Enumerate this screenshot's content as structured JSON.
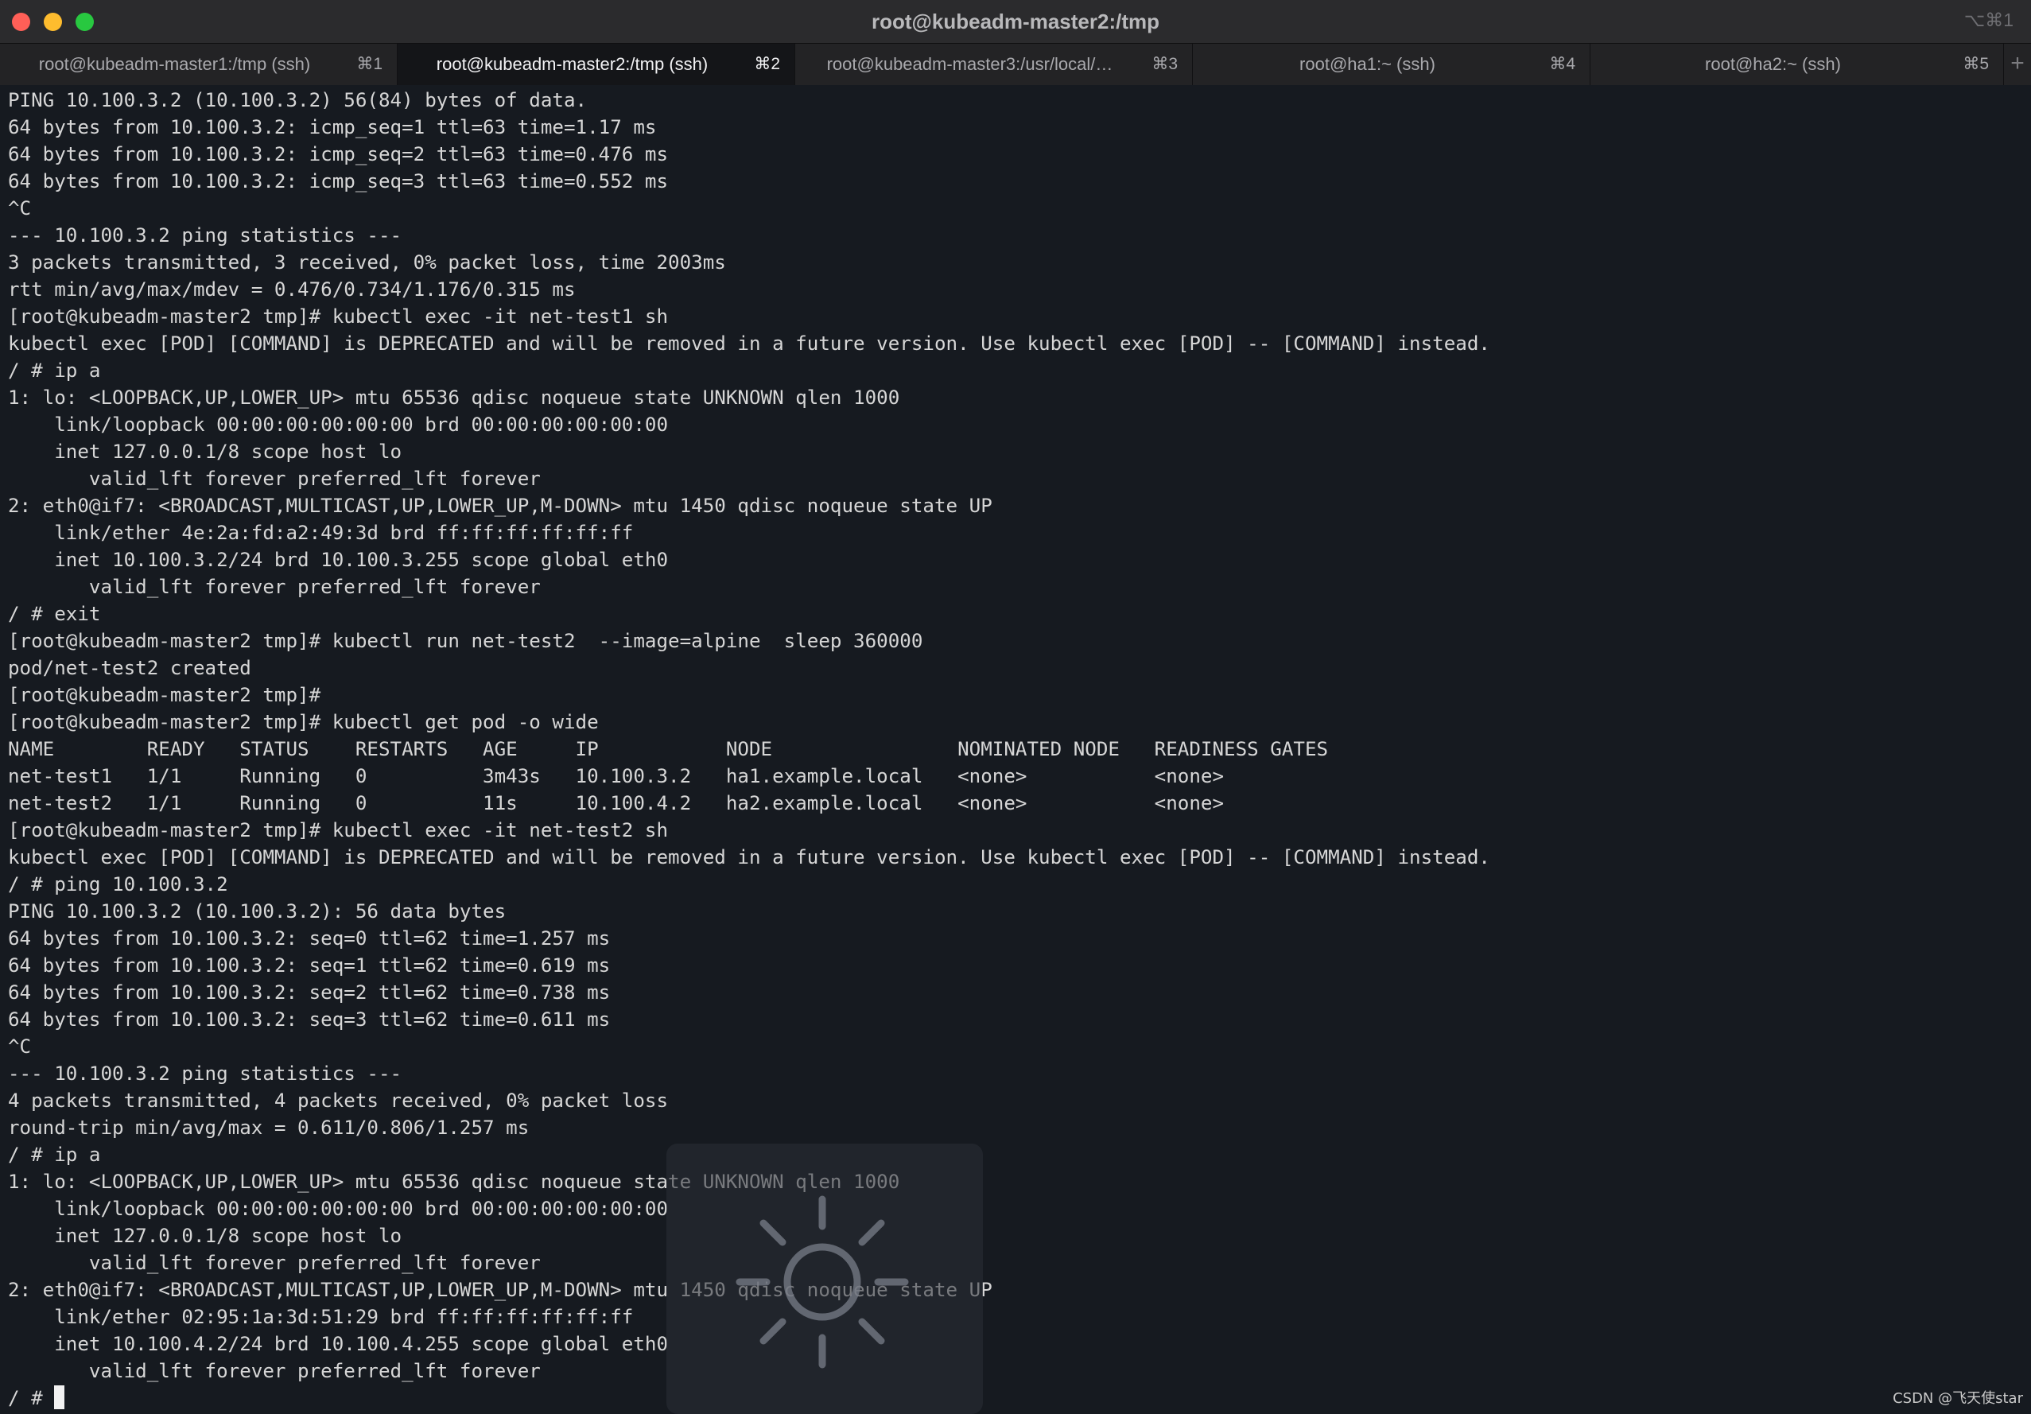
{
  "window": {
    "title": "root@kubeadm-master2:/tmp",
    "shortcut": "⌥⌘1"
  },
  "tabs": [
    {
      "label": "root@kubeadm-master1:/tmp (ssh)",
      "shortcut": "⌘1",
      "active": false
    },
    {
      "label": "root@kubeadm-master2:/tmp (ssh)",
      "shortcut": "⌘2",
      "active": true
    },
    {
      "label": "root@kubeadm-master3:/usr/local/…",
      "shortcut": "⌘3",
      "active": false
    },
    {
      "label": "root@ha1:~ (ssh)",
      "shortcut": "⌘4",
      "active": false
    },
    {
      "label": "root@ha2:~ (ssh)",
      "shortcut": "⌘5",
      "active": false
    }
  ],
  "new_tab_label": "+",
  "terminal": {
    "lines": [
      "PING 10.100.3.2 (10.100.3.2) 56(84) bytes of data.",
      "64 bytes from 10.100.3.2: icmp_seq=1 ttl=63 time=1.17 ms",
      "64 bytes from 10.100.3.2: icmp_seq=2 ttl=63 time=0.476 ms",
      "64 bytes from 10.100.3.2: icmp_seq=3 ttl=63 time=0.552 ms",
      "^C",
      "--- 10.100.3.2 ping statistics ---",
      "3 packets transmitted, 3 received, 0% packet loss, time 2003ms",
      "rtt min/avg/max/mdev = 0.476/0.734/1.176/0.315 ms",
      "[root@kubeadm-master2 tmp]# kubectl exec -it net-test1 sh",
      "kubectl exec [POD] [COMMAND] is DEPRECATED and will be removed in a future version. Use kubectl exec [POD] -- [COMMAND] instead.",
      "/ # ip a",
      "1: lo: <LOOPBACK,UP,LOWER_UP> mtu 65536 qdisc noqueue state UNKNOWN qlen 1000",
      "    link/loopback 00:00:00:00:00:00 brd 00:00:00:00:00:00",
      "    inet 127.0.0.1/8 scope host lo",
      "       valid_lft forever preferred_lft forever",
      "2: eth0@if7: <BROADCAST,MULTICAST,UP,LOWER_UP,M-DOWN> mtu 1450 qdisc noqueue state UP",
      "    link/ether 4e:2a:fd:a2:49:3d brd ff:ff:ff:ff:ff:ff",
      "    inet 10.100.3.2/24 brd 10.100.3.255 scope global eth0",
      "       valid_lft forever preferred_lft forever",
      "/ # exit",
      "[root@kubeadm-master2 tmp]# kubectl run net-test2  --image=alpine  sleep 360000",
      "pod/net-test2 created",
      "[root@kubeadm-master2 tmp]#",
      "[root@kubeadm-master2 tmp]# kubectl get pod -o wide",
      "NAME        READY   STATUS    RESTARTS   AGE     IP           NODE                NOMINATED NODE   READINESS GATES",
      "net-test1   1/1     Running   0          3m43s   10.100.3.2   ha1.example.local   <none>           <none>",
      "net-test2   1/1     Running   0          11s     10.100.4.2   ha2.example.local   <none>           <none>",
      "[root@kubeadm-master2 tmp]# kubectl exec -it net-test2 sh",
      "kubectl exec [POD] [COMMAND] is DEPRECATED and will be removed in a future version. Use kubectl exec [POD] -- [COMMAND] instead.",
      "/ # ping 10.100.3.2",
      "PING 10.100.3.2 (10.100.3.2): 56 data bytes",
      "64 bytes from 10.100.3.2: seq=0 ttl=62 time=1.257 ms",
      "64 bytes from 10.100.3.2: seq=1 ttl=62 time=0.619 ms",
      "64 bytes from 10.100.3.2: seq=2 ttl=62 time=0.738 ms",
      "64 bytes from 10.100.3.2: seq=3 ttl=62 time=0.611 ms",
      "^C",
      "--- 10.100.3.2 ping statistics ---",
      "4 packets transmitted, 4 packets received, 0% packet loss",
      "round-trip min/avg/max = 0.611/0.806/1.257 ms",
      "/ # ip a",
      "1: lo: <LOOPBACK,UP,LOWER_UP> mtu 65536 qdisc noqueue state UNKNOWN qlen 1000",
      "    link/loopback 00:00:00:00:00:00 brd 00:00:00:00:00:00",
      "    inet 127.0.0.1/8 scope host lo",
      "       valid_lft forever preferred_lft forever",
      "2: eth0@if7: <BROADCAST,MULTICAST,UP,LOWER_UP,M-DOWN> mtu 1450 qdisc noqueue state UP",
      "    link/ether 02:95:1a:3d:51:29 brd ff:ff:ff:ff:ff:ff",
      "    inet 10.100.4.2/24 brd 10.100.4.255 scope global eth0",
      "       valid_lft forever preferred_lft forever"
    ],
    "prompt": "/ # "
  },
  "hud_icon": "brightness-icon",
  "watermark": "CSDN @飞天使star",
  "colors": {
    "close": "#ff5f57",
    "minimize": "#febc2e",
    "zoom": "#28c840",
    "terminal_bg": "#161a20",
    "terminal_fg": "#d6d6d6"
  }
}
